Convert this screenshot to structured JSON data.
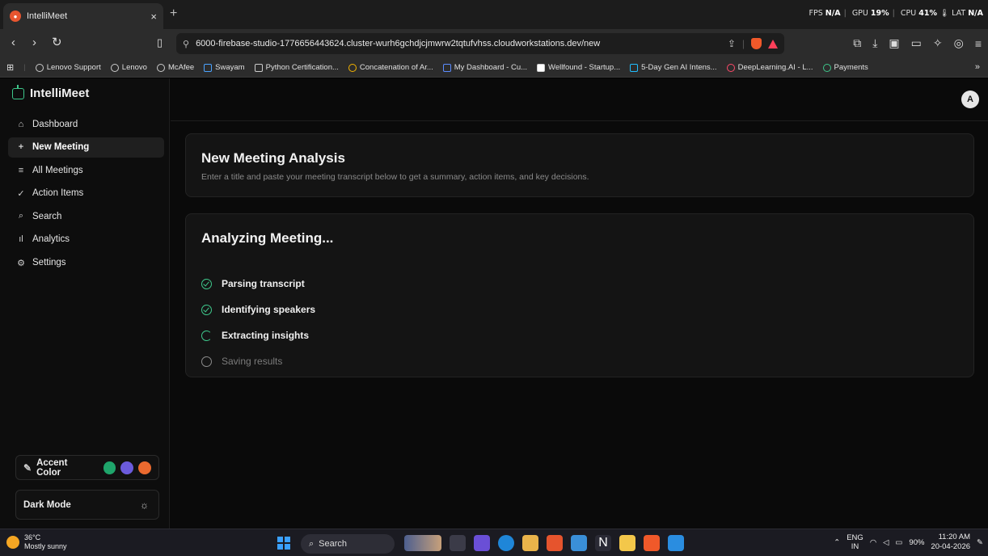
{
  "browser": {
    "tab_title": "IntelliMeet",
    "perf": {
      "fps_label": "FPS",
      "fps": "N/A",
      "gpu_label": "GPU",
      "gpu": "19%",
      "cpu_label": "CPU",
      "cpu": "41%",
      "lat_label": "LAT",
      "lat": "N/A"
    },
    "url": "6000-firebase-studio-1776656443624.cluster-wurh6gchdjcjmwrw2tqtufvhss.cloudworkstations.dev/new",
    "bookmarks": [
      "Lenovo Support",
      "Lenovo",
      "McAfee",
      "Swayam",
      "Python Certification...",
      "Concatenation of Ar...",
      "My Dashboard - Cu...",
      "Wellfound - Startup...",
      "5-Day Gen AI Intens...",
      "DeepLearning.AI - L...",
      "Payments"
    ]
  },
  "app": {
    "brand": "IntelliMeet",
    "avatar": "A",
    "nav": [
      {
        "label": "Dashboard",
        "icon": "home-icon",
        "glyph": "⌂"
      },
      {
        "label": "New Meeting",
        "icon": "plus-icon",
        "glyph": "+"
      },
      {
        "label": "All Meetings",
        "icon": "list-icon",
        "glyph": "≡"
      },
      {
        "label": "Action Items",
        "icon": "check-list-icon",
        "glyph": "✓"
      },
      {
        "label": "Search",
        "icon": "search-icon",
        "glyph": "⌕"
      },
      {
        "label": "Analytics",
        "icon": "bar-chart-icon",
        "glyph": "ıl"
      },
      {
        "label": "Settings",
        "icon": "gear-icon",
        "glyph": "⚙"
      }
    ],
    "active_nav": "New Meeting",
    "accent_label": "Accent Color",
    "accent_colors": [
      "#1fa56b",
      "#6b5bdc",
      "#ea6a2f"
    ],
    "dark_mode_label": "Dark Mode",
    "card1": {
      "title": "New Meeting Analysis",
      "subtitle": "Enter a title and paste your meeting transcript below to get a summary, action items, and key decisions."
    },
    "card2": {
      "title": "Analyzing Meeting...",
      "steps": [
        {
          "label": "Parsing transcript",
          "status": "done"
        },
        {
          "label": "Identifying speakers",
          "status": "done"
        },
        {
          "label": "Extracting insights",
          "status": "in-progress"
        },
        {
          "label": "Saving results",
          "status": "pending"
        }
      ]
    }
  },
  "taskbar": {
    "temp": "36°C",
    "weather": "Mostly sunny",
    "search": "Search",
    "lang_top": "ENG",
    "lang_bottom": "IN",
    "battery": "90%",
    "time": "11:20 AM",
    "date": "20-04-2026"
  }
}
